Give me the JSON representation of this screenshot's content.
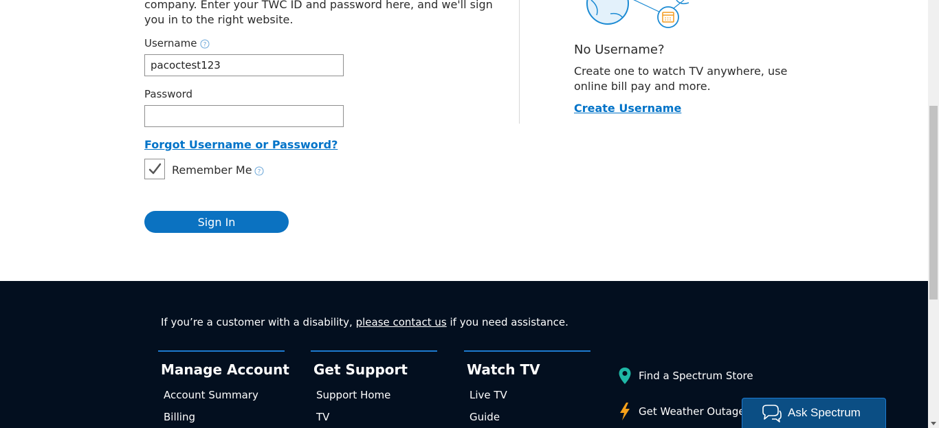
{
  "signin": {
    "intro_text": "company. Enter your TWC ID and password here, and we'll sign you in to the right website.",
    "username_label": "Username",
    "username_value": "pacoctest123",
    "password_label": "Password",
    "password_value": "",
    "forgot_link": "Forgot Username or Password?",
    "remember_label": "Remember Me",
    "remember_checked": true,
    "signin_button": "Sign In"
  },
  "create": {
    "title": "No Username?",
    "description": "Create one to watch TV anywhere, use online bill pay and more.",
    "link": "Create Username"
  },
  "footer": {
    "access_prefix": "If you’re a customer with a disability, ",
    "access_link": "please contact us",
    "access_suffix": " if you need assistance.",
    "columns": [
      {
        "title": "Manage Account",
        "links": [
          "Account Summary",
          "Billing"
        ]
      },
      {
        "title": "Get Support",
        "links": [
          "Support Home",
          "TV"
        ]
      },
      {
        "title": "Watch TV",
        "links": [
          "Live TV",
          "Guide"
        ]
      }
    ],
    "side_links": [
      "Find a Spectrum Store",
      "Get Weather Outage"
    ],
    "ask_button": "Ask Spectrum"
  },
  "colors": {
    "link_blue": "#0073c8",
    "button_blue": "#0b72c1",
    "footer_bg": "#030f1f",
    "column_rule": "#1d7ad0",
    "map_pin": "#1fb7a6",
    "bolt": "#f7a11a"
  },
  "icons": [
    "help-circle-icon",
    "checkmark-icon",
    "globe-icon",
    "calendar-icon",
    "map-pin-icon",
    "lightning-icon",
    "chat-bubbles-icon"
  ]
}
